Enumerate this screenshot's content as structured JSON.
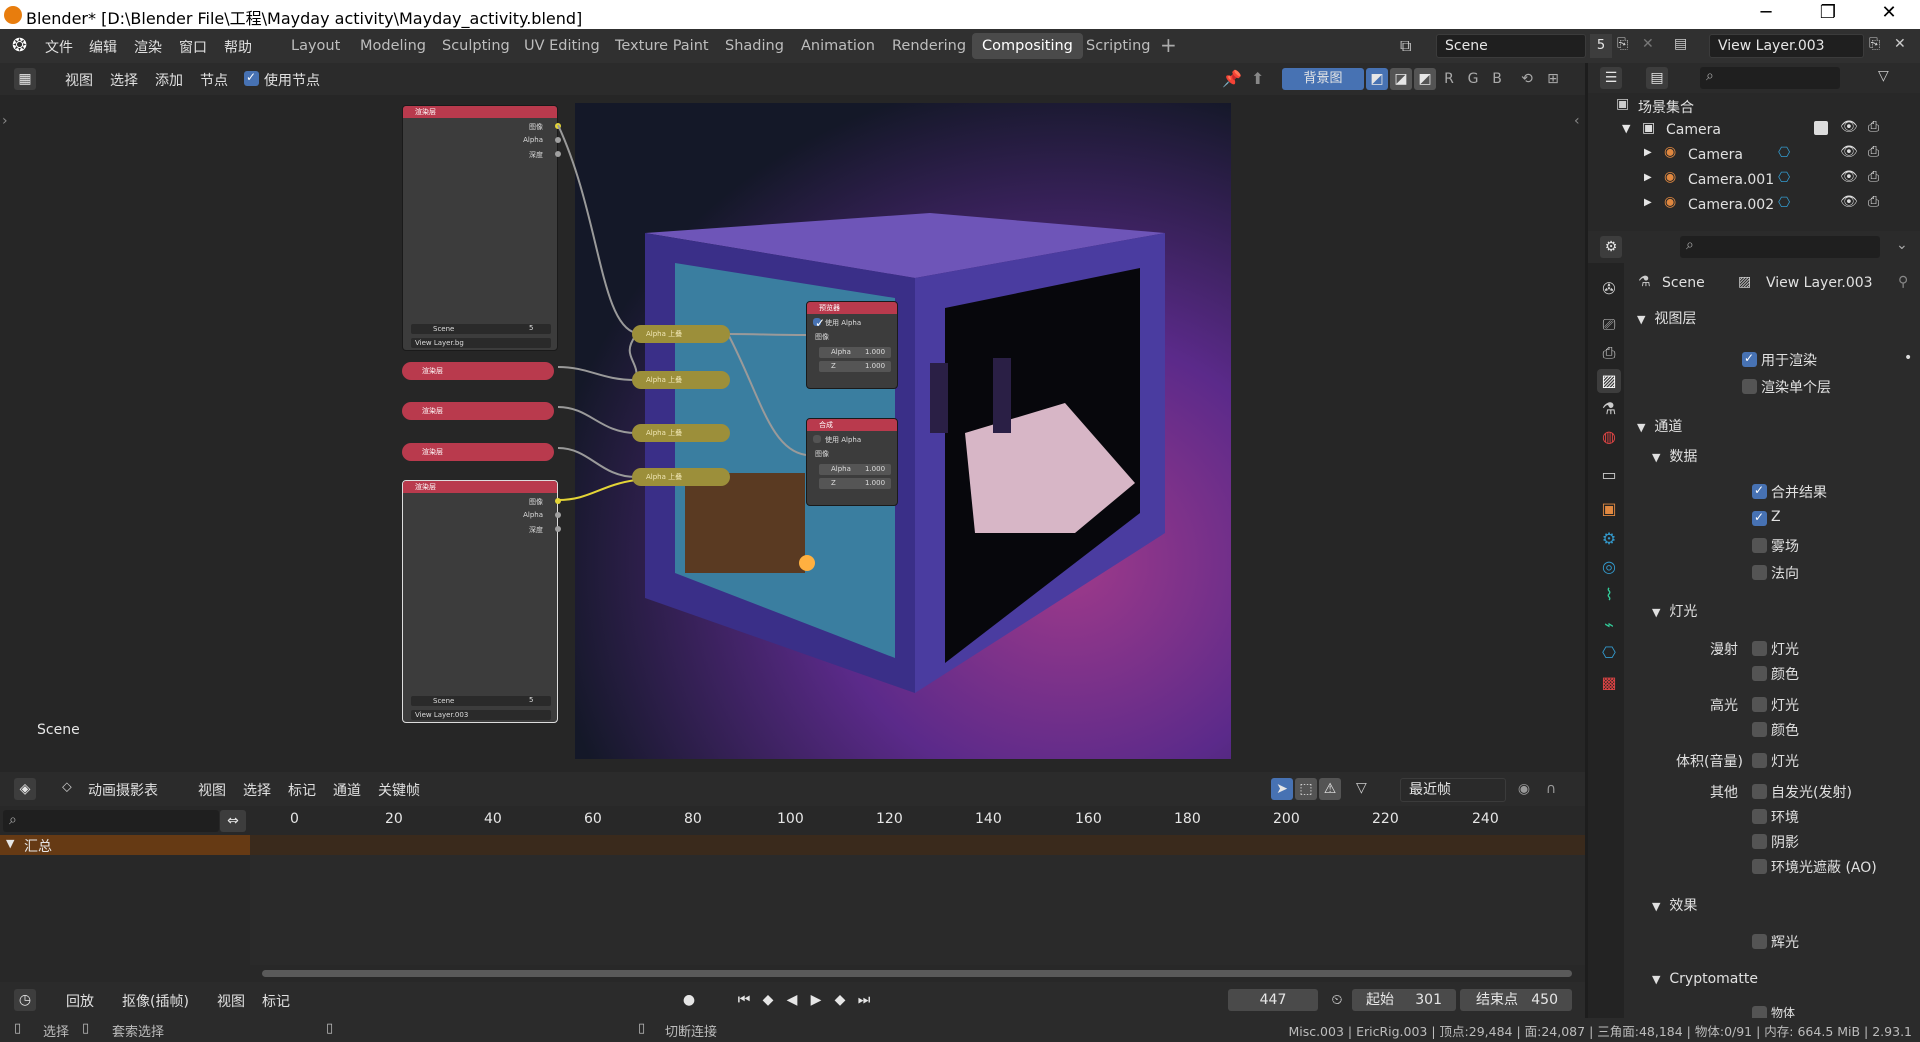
{
  "window": {
    "title": "Blender* [D:\\Blender File\\工程\\Mayday activity\\Mayday_activity.blend]",
    "minimize": "─",
    "maximize": "❐",
    "close": "✕"
  },
  "menu": {
    "items": [
      "文件",
      "编辑",
      "渲染",
      "窗口",
      "帮助"
    ]
  },
  "workspaces": [
    "Layout",
    "Modeling",
    "Sculpting",
    "UV Editing",
    "Texture Paint",
    "Shading",
    "Animation",
    "Rendering",
    "Compositing",
    "Scripting"
  ],
  "workspace_add": "+",
  "scene": {
    "name": "Scene",
    "users": "5",
    "view_layer": "View Layer.003"
  },
  "node_header": {
    "menus": [
      "视图",
      "选择",
      "添加",
      "节点"
    ],
    "use_nodes_label": "使用节点",
    "use_nodes": true,
    "backdrop_label": "背景图",
    "channels": [
      "R",
      "G",
      "B"
    ]
  },
  "node_editor": {
    "scene_label": "Scene",
    "render_layer_title": "渲染层",
    "outputs": [
      "图像",
      "Alpha",
      "深度"
    ],
    "node1": {
      "scene": "Scene",
      "users": "5",
      "layer": "View Layer.bg"
    },
    "node5": {
      "scene": "Scene",
      "users": "5",
      "layer": "View Layer.003"
    },
    "mix_label": "Alpha 上叠",
    "viewer": {
      "title": "预览器",
      "use_alpha": "使用 Alpha",
      "image": "图像",
      "alpha": "Alpha",
      "alpha_val": "1.000",
      "z": "Z",
      "z_val": "1.000"
    },
    "composite": {
      "title": "合成",
      "use_alpha": "使用 Alpha",
      "image": "图像",
      "alpha": "Alpha",
      "alpha_val": "1.000",
      "z": "Z",
      "z_val": "1.000"
    }
  },
  "timeline": {
    "editor": "动画摄影表",
    "menus": [
      "视图",
      "选择",
      "标记",
      "通道",
      "关键帧"
    ],
    "snap": "最近帧",
    "ticks": [
      "0",
      "20",
      "40",
      "60",
      "80",
      "100",
      "120",
      "140",
      "160",
      "180",
      "200",
      "220",
      "240"
    ],
    "summary": "汇总"
  },
  "playback": {
    "menus": [
      "回放",
      "抠像(插帧)",
      "视图",
      "标记"
    ],
    "current_frame": "447",
    "start_label": "起始",
    "start": "301",
    "end_label": "结束点",
    "end": "450"
  },
  "status": {
    "select": "选择",
    "box_select": "套索选择",
    "cut": "切断连接",
    "info": "Misc.003 | EricRig.003 | 顶点:29,484 | 面:24,087 | 三角面:48,184 | 物体:0/91 | 内存: 664.5 MiB | 2.93.1"
  },
  "outliner": {
    "collection": "场景集合",
    "items": [
      {
        "name": "Camera",
        "level": 1
      },
      {
        "name": "Camera",
        "level": 2
      },
      {
        "name": "Camera.001",
        "level": 2
      },
      {
        "name": "Camera.002",
        "level": 2
      }
    ]
  },
  "properties": {
    "breadcrumb_scene": "Scene",
    "breadcrumb_layer": "View Layer.003",
    "view_layer_section": "视图层",
    "use_render": "用于渲染",
    "render_single": "渲染单个层",
    "passes": "通道",
    "data": "数据",
    "combined": "合并结果",
    "z": "Z",
    "mist": "雾场",
    "normal": "法向",
    "light": "灯光",
    "diffuse": "漫射",
    "specular": "高光",
    "volume": "体积(音量)",
    "other": "其他",
    "light_pass": "灯光",
    "color_pass": "颜色",
    "emission": "自发光(发射)",
    "environment": "环境",
    "shadow": "阴影",
    "ao": "环境光遮蔽 (AO)",
    "effects": "效果",
    "bloom": "辉光",
    "cryptomatte": "Cryptomatte",
    "object": "物体"
  }
}
